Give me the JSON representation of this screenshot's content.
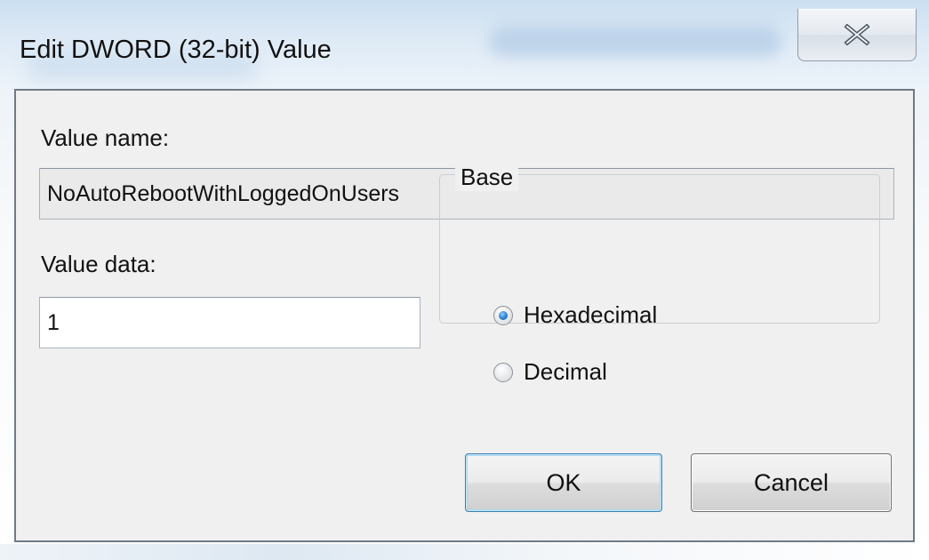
{
  "window": {
    "title": "Edit DWORD (32-bit) Value",
    "close_glyph": "×"
  },
  "form": {
    "value_name_label": "Value name:",
    "value_name": "NoAutoRebootWithLoggedOnUsers",
    "value_data_label": "Value data:",
    "value_data": "1",
    "base_label": "Base",
    "base_options": [
      {
        "label": "Hexadecimal",
        "selected": true
      },
      {
        "label": "Decimal",
        "selected": false
      }
    ]
  },
  "buttons": {
    "ok": "OK",
    "cancel": "Cancel"
  },
  "colors": {
    "accent_radio": "#2a7fd4",
    "default_button_border": "#3c7fb1"
  },
  "icons": {
    "close": "close-icon",
    "radio_selected": "radio-selected-icon",
    "radio_unselected": "radio-unselected-icon"
  }
}
